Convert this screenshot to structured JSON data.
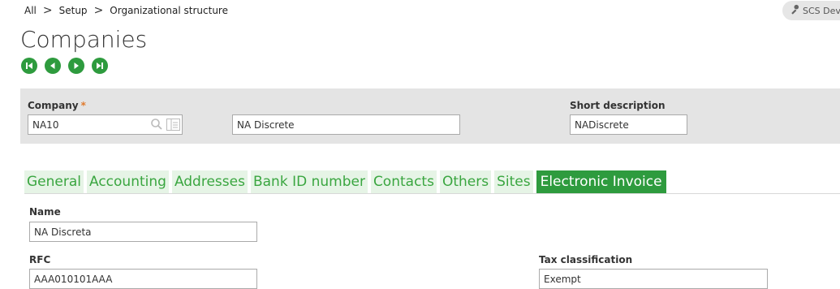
{
  "breadcrumb": [
    "All",
    "Setup",
    "Organizational structure"
  ],
  "breadcrumb_sep": ">",
  "user_label": "SCS Dev",
  "page_title": "Companies",
  "nav_buttons": [
    "first-icon",
    "previous-icon",
    "next-icon",
    "last-icon"
  ],
  "header": {
    "company_label": "Company",
    "required_marker": "*",
    "company_value": "NA10",
    "company_name_value": "NA Discrete",
    "short_description_label": "Short description",
    "short_description_value": "NADiscrete"
  },
  "tabs": [
    "General",
    "Accounting",
    "Addresses",
    "Bank ID number",
    "Contacts",
    "Others",
    "Sites",
    "Electronic Invoice"
  ],
  "active_tab": "Electronic Invoice",
  "section": {
    "name_label": "Name",
    "name_value": "NA Discreta",
    "rfc_label": "RFC",
    "rfc_value": "AAA010101AAA",
    "tax_classification_label": "Tax classification",
    "tax_classification_value": "Exempt"
  },
  "colors": {
    "accent_green": "#2e9b3e",
    "tab_bg": "#e6f4e6",
    "tab_text": "#3aa640",
    "required": "#e07a2d",
    "panel_bg": "#e4e4e4"
  }
}
